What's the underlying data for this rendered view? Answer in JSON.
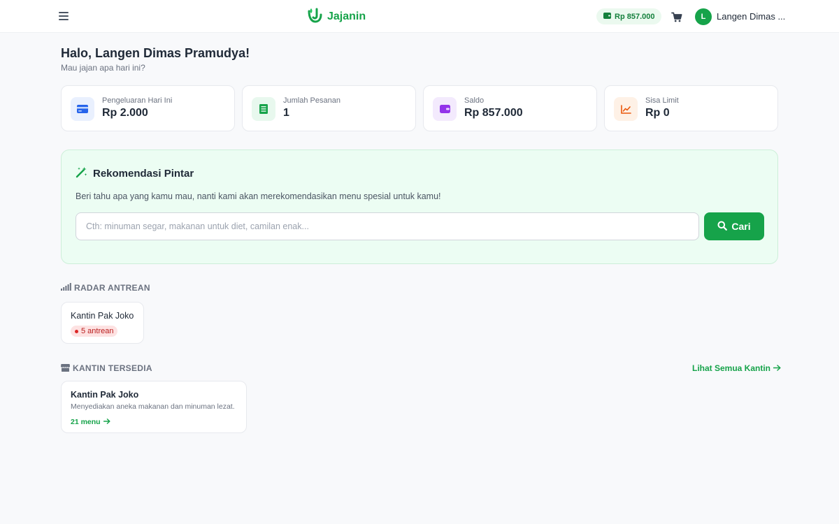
{
  "header": {
    "brand_name": "Jajanin",
    "balance": "Rp 857.000",
    "user_initial": "L",
    "user_name": "Langen Dimas ..."
  },
  "greeting": {
    "title": "Halo, Langen Dimas Pramudya!",
    "subtitle": "Mau jajan apa hari ini?"
  },
  "stats": [
    {
      "label": "Pengeluaran Hari Ini",
      "value": "Rp 2.000",
      "icon": "credit-card-icon",
      "color": "#2563eb"
    },
    {
      "label": "Jumlah Pesanan",
      "value": "1",
      "icon": "receipt-icon",
      "color": "#16a34a"
    },
    {
      "label": "Saldo",
      "value": "Rp 857.000",
      "icon": "wallet-icon",
      "color": "#9333ea"
    },
    {
      "label": "Sisa Limit",
      "value": "Rp 0",
      "icon": "trend-chart-icon",
      "color": "#ea580c"
    }
  ],
  "recommendation": {
    "title": "Rekomendasi Pintar",
    "description": "Beri tahu apa yang kamu mau, nanti kami akan merekomendasikan menu spesial untuk kamu!",
    "input_value": "",
    "placeholder": "Cth: minuman segar, makanan untuk diet, camilan enak...",
    "button_label": "Cari"
  },
  "queue_radar": {
    "title": "RADAR ANTREAN",
    "items": [
      {
        "name": "Kantin Pak Joko",
        "badge": "5 antrean"
      }
    ]
  },
  "canteens": {
    "title": "KANTIN TERSEDIA",
    "see_all": "Lihat Semua Kantin",
    "items": [
      {
        "name": "Kantin Pak Joko",
        "description": "Menyediakan aneka makanan dan minuman lezat.",
        "menu_count": "21 menu"
      }
    ]
  },
  "colors": {
    "primary": "#16a34a",
    "reco_bg": "#ecfdf3",
    "badge_red": "#b91c1c"
  }
}
